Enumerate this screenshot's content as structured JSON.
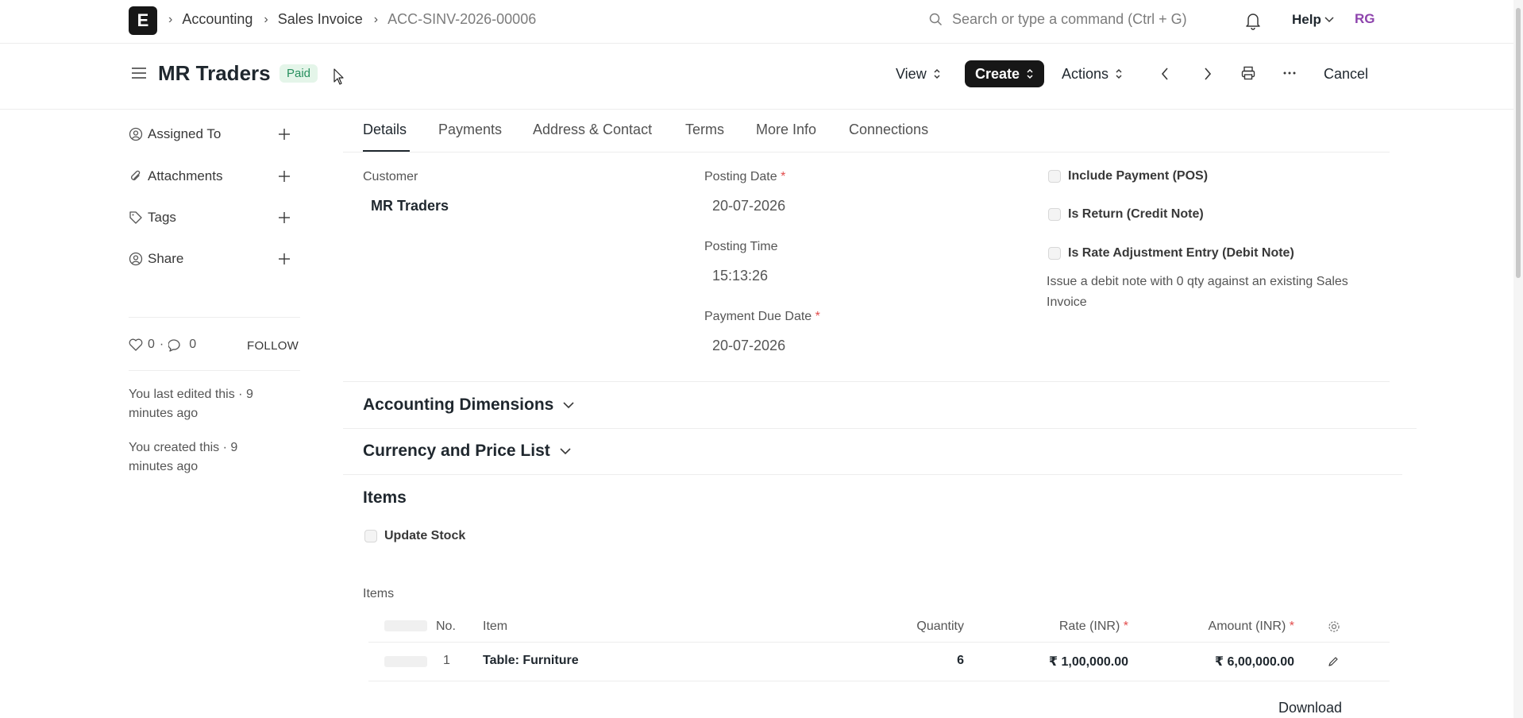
{
  "nav": {
    "logo_letter": "E",
    "breadcrumbs": [
      "Accounting",
      "Sales Invoice",
      "ACC-SINV-2026-00006"
    ],
    "search_placeholder": "Search or type a command (Ctrl + G)",
    "help_label": "Help",
    "user_initials": "RG"
  },
  "header": {
    "title": "MR Traders",
    "status_badge": "Paid",
    "view_label": "View",
    "create_label": "Create",
    "actions_label": "Actions",
    "cancel_label": "Cancel"
  },
  "sidebar": {
    "assigned_to": "Assigned To",
    "attachments": "Attachments",
    "tags": "Tags",
    "share": "Share",
    "likes_count": "0",
    "comments_count": "0",
    "follow_label": "FOLLOW",
    "last_edited": "You last edited this · 9 minutes ago",
    "created": "You created this · 9 minutes ago"
  },
  "tabs": [
    "Details",
    "Payments",
    "Address & Contact",
    "Terms",
    "More Info",
    "Connections"
  ],
  "details": {
    "customer_label": "Customer",
    "customer_value": "MR Traders",
    "posting_date_label": "Posting Date",
    "posting_date_value": "20-07-2026",
    "posting_time_label": "Posting Time",
    "posting_time_value": "15:13:26",
    "due_date_label": "Payment Due Date",
    "due_date_value": "20-07-2026",
    "include_payment_label": "Include Payment (POS)",
    "is_return_label": "Is Return (Credit Note)",
    "rate_adjustment_label": "Is Rate Adjustment Entry (Debit Note)",
    "rate_adjustment_desc": "Issue a debit note with 0 qty against an existing Sales Invoice"
  },
  "sections": {
    "accounting_dimensions": "Accounting Dimensions",
    "currency_price_list": "Currency and Price List",
    "items_heading": "Items",
    "update_stock_label": "Update Stock",
    "items_table_label": "Items"
  },
  "items_table": {
    "columns": {
      "no": "No.",
      "item": "Item",
      "quantity": "Quantity",
      "rate": "Rate (INR)",
      "amount": "Amount (INR)"
    },
    "rows": [
      {
        "no": "1",
        "item": "Table: Furniture",
        "quantity": "6",
        "rate": "₹ 1,00,000.00",
        "amount": "₹ 6,00,000.00"
      }
    ],
    "download_label": "Download"
  }
}
